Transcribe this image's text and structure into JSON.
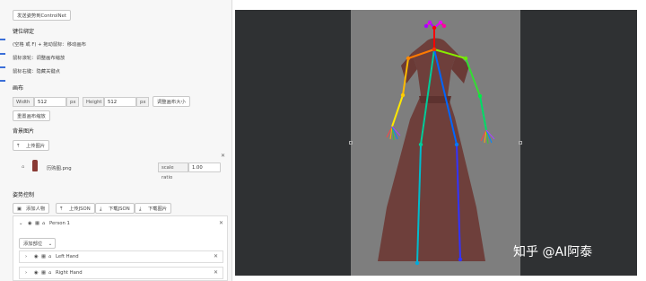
{
  "top_button": "发送姿势到ControlNet",
  "sections": {
    "keys": "键位绑定",
    "canvas": "画布",
    "bg": "背景图片",
    "pose": "姿势控制"
  },
  "keys_lines": [
    "(空格 或 F) + 拖动鼠标：移动画布",
    "鼠标滚轮：调整画布缩放",
    "鼠标右键：隐藏关键点"
  ],
  "canvas_settings": {
    "width_label": "Width",
    "width_value": "512",
    "height_label": "Height",
    "height_value": "512",
    "unit": "px",
    "resize_button": "调整画布大小",
    "reset_button": "重置画布缩放"
  },
  "background": {
    "upload_button": "上传图片",
    "filename": "历购图.png",
    "scale_label": "scale ratio",
    "scale_value": "1.00"
  },
  "pose_controls": {
    "add_person": "添加人物",
    "upload_json": "上传JSON",
    "download_json": "下载JSON",
    "download_image": "下载图片",
    "person_name": "Person 1",
    "add_part": "添加部位",
    "parts": [
      "Left Hand",
      "Right Hand"
    ]
  },
  "watermark": "知乎 @AI阿泰",
  "colors": {
    "panel_bg": "#f7f7f7",
    "canvas_bg": "#2f3133",
    "canvas_area": "#7e7e7e",
    "dress": "#6e3f3b"
  }
}
